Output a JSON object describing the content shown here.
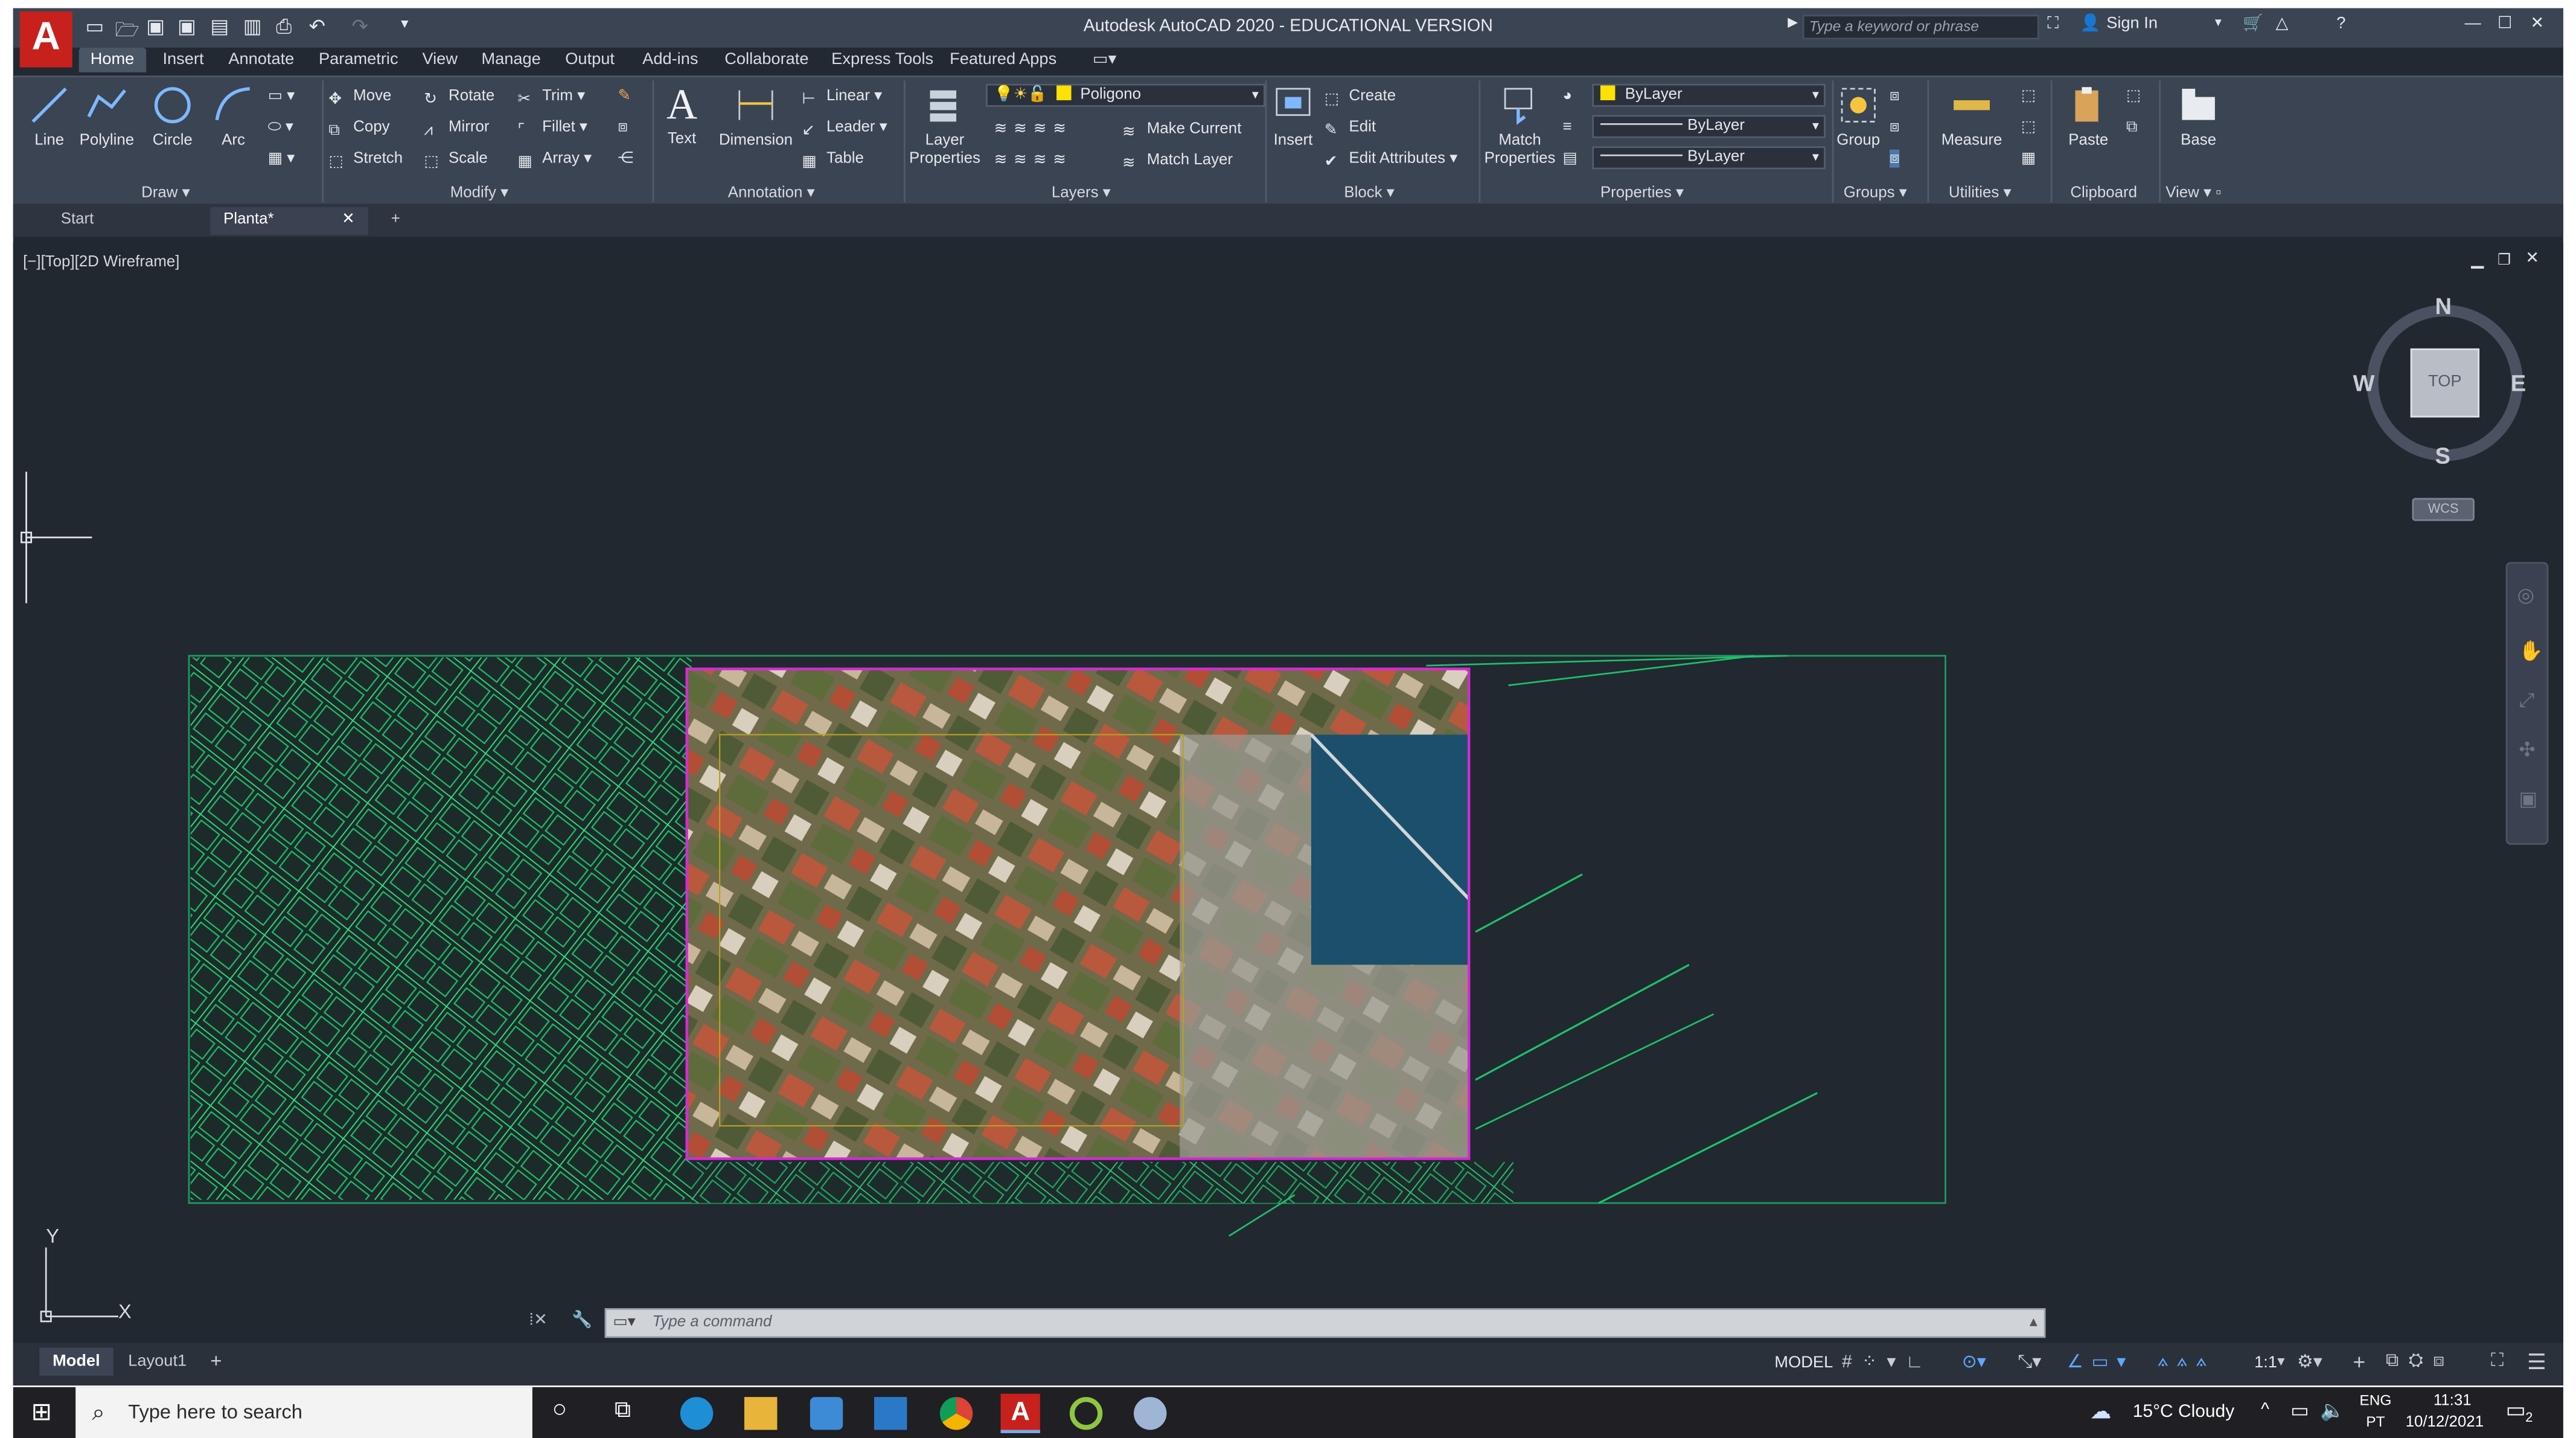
{
  "app": {
    "title": "Autodesk AutoCAD 2020 - EDUCATIONAL VERSION",
    "logo": "A"
  },
  "search": {
    "placeholder": "Type a keyword or phrase"
  },
  "account": {
    "sign_in": "Sign In"
  },
  "menu_tabs": [
    "Home",
    "Insert",
    "Annotate",
    "Parametric",
    "View",
    "Manage",
    "Output",
    "Add-ins",
    "Collaborate",
    "Express Tools",
    "Featured Apps"
  ],
  "ribbon": {
    "draw": {
      "label": "Draw",
      "line": "Line",
      "polyline": "Polyline",
      "circle": "Circle",
      "arc": "Arc"
    },
    "modify": {
      "label": "Modify",
      "move": "Move",
      "rotate": "Rotate",
      "trim": "Trim",
      "copy": "Copy",
      "mirror": "Mirror",
      "fillet": "Fillet",
      "stretch": "Stretch",
      "scale": "Scale",
      "array": "Array"
    },
    "annotation": {
      "label": "Annotation",
      "text": "Text",
      "dimension": "Dimension",
      "linear": "Linear",
      "leader": "Leader",
      "table": "Table"
    },
    "layers": {
      "label": "Layers",
      "layer_properties": "Layer Properties",
      "current_layer": "Poligono",
      "make_current": "Make Current",
      "match_layer": "Match Layer"
    },
    "block": {
      "label": "Block",
      "insert": "Insert",
      "create": "Create",
      "edit": "Edit",
      "edit_attributes": "Edit Attributes"
    },
    "properties": {
      "label": "Properties",
      "match_properties": "Match Properties",
      "color": "ByLayer",
      "linetype": "ByLayer",
      "lineweight": "ByLayer"
    },
    "groups": {
      "label": "Groups",
      "group": "Group"
    },
    "utilities": {
      "label": "Utilities",
      "measure": "Measure"
    },
    "clipboard": {
      "label": "Clipboard",
      "paste": "Paste"
    },
    "view": {
      "label": "View",
      "base": "Base"
    }
  },
  "doc_tabs": {
    "start": "Start",
    "active": "Planta*"
  },
  "viewport": {
    "label": "[−][Top][2D Wireframe]"
  },
  "viewcube": {
    "n": "N",
    "s": "S",
    "e": "E",
    "w": "W",
    "top": "TOP",
    "wcs": "WCS"
  },
  "ucs": {
    "y": "Y",
    "x": "X"
  },
  "command": {
    "placeholder": "Type a command"
  },
  "layout_tabs": [
    "Model",
    "Layout1"
  ],
  "status": {
    "model": "MODEL",
    "scale": "1:1"
  },
  "taskbar": {
    "search": "Type here to search",
    "weather": "15°C  Cloudy",
    "lang1": "ENG",
    "lang2": "PT",
    "time": "11:31",
    "date": "10/12/2021",
    "notif": "2"
  },
  "colors": {
    "accent_layer": "#ffe100",
    "aerial_border": "#d62ad6",
    "map_lines": "#1fbf6a"
  }
}
